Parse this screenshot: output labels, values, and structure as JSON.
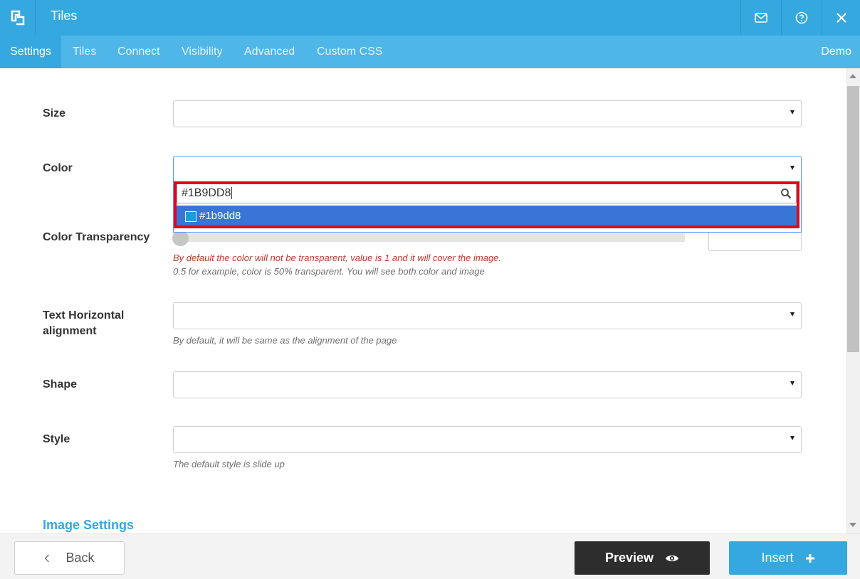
{
  "header": {
    "title": "Tiles",
    "logo_icon": "brand-logo-icon",
    "actions": [
      {
        "name": "mail-icon"
      },
      {
        "name": "help-icon"
      },
      {
        "name": "close-icon"
      }
    ]
  },
  "tabs": {
    "items": [
      {
        "label": "Settings",
        "active": true
      },
      {
        "label": "Tiles",
        "active": false
      },
      {
        "label": "Connect",
        "active": false
      },
      {
        "label": "Visibility",
        "active": false
      },
      {
        "label": "Advanced",
        "active": false
      },
      {
        "label": "Custom CSS",
        "active": false
      }
    ],
    "demo_label": "Demo"
  },
  "form": {
    "size": {
      "label": "Size",
      "value": ""
    },
    "color": {
      "label": "Color",
      "value": "",
      "search_value": "#1B9DD8",
      "options": [
        {
          "label": "#1b9dd8",
          "swatch": "#1b9dd8",
          "highlighted": true
        }
      ]
    },
    "transparency": {
      "label": "Color Transparency",
      "value": "",
      "help_warning": "By default the color will not be transparent, value is 1 and it will cover the image.",
      "help_text": "0.5 for example, color is 50% transparent. You will see both color and image"
    },
    "text_alignment": {
      "label_line1": "Text Horizontal",
      "label_line2": "alignment",
      "value": "",
      "help_text": "By default, it will be same as the alignment of the page"
    },
    "shape": {
      "label": "Shape",
      "value": ""
    },
    "style": {
      "label": "Style",
      "value": "",
      "help_text": "The default style is slide up"
    },
    "image_settings_title": "Image Settings"
  },
  "footer": {
    "back_label": "Back",
    "preview_label": "Preview",
    "insert_label": "Insert"
  },
  "colors": {
    "primary": "#35a8e0",
    "tab_bar": "#4fb6e8",
    "highlight_option": "#3875d7",
    "annotation_border": "#e30613",
    "preview_bg": "#2d2d2d",
    "warning_text": "#c0392b"
  }
}
